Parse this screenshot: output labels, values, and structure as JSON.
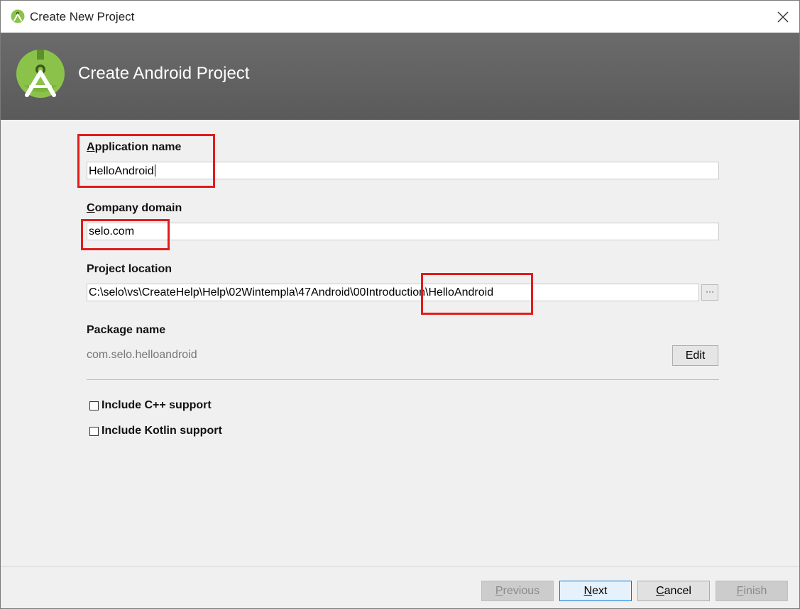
{
  "window": {
    "title": "Create New Project",
    "close_icon": "close-icon"
  },
  "banner": {
    "title": "Create Android Project",
    "logo": "android-studio-logo"
  },
  "form": {
    "app_name": {
      "label_mnemonic": "A",
      "label_rest": "pplication name",
      "value": "HelloAndroid"
    },
    "company_domain": {
      "label_mnemonic": "C",
      "label_rest": "ompany domain",
      "value": "selo.com"
    },
    "project_location": {
      "label": "Project location",
      "value": "C:\\selo\\vs\\CreateHelp\\Help\\02Wintempla\\47Android\\00Introduction\\HelloAndroid",
      "browse_label": "···"
    },
    "package_name": {
      "label": "Package name",
      "value": "com.selo.helloandroid",
      "edit_label": "Edit"
    },
    "include_cpp": {
      "label": "Include C++ support",
      "checked": false
    },
    "include_kotlin": {
      "label": "Include Kotlin support",
      "checked": false
    }
  },
  "footer": {
    "previous": {
      "mnemonic": "P",
      "rest": "revious",
      "enabled": false
    },
    "next": {
      "mnemonic": "N",
      "rest": "ext",
      "enabled": true
    },
    "cancel": {
      "mnemonic": "C",
      "rest": "ancel",
      "enabled": true
    },
    "finish": {
      "mnemonic": "F",
      "rest": "inish",
      "enabled": false
    }
  },
  "colors": {
    "highlight_red": "#e31b1b",
    "banner_gray": "#616161",
    "android_green": "#8bc34a"
  }
}
